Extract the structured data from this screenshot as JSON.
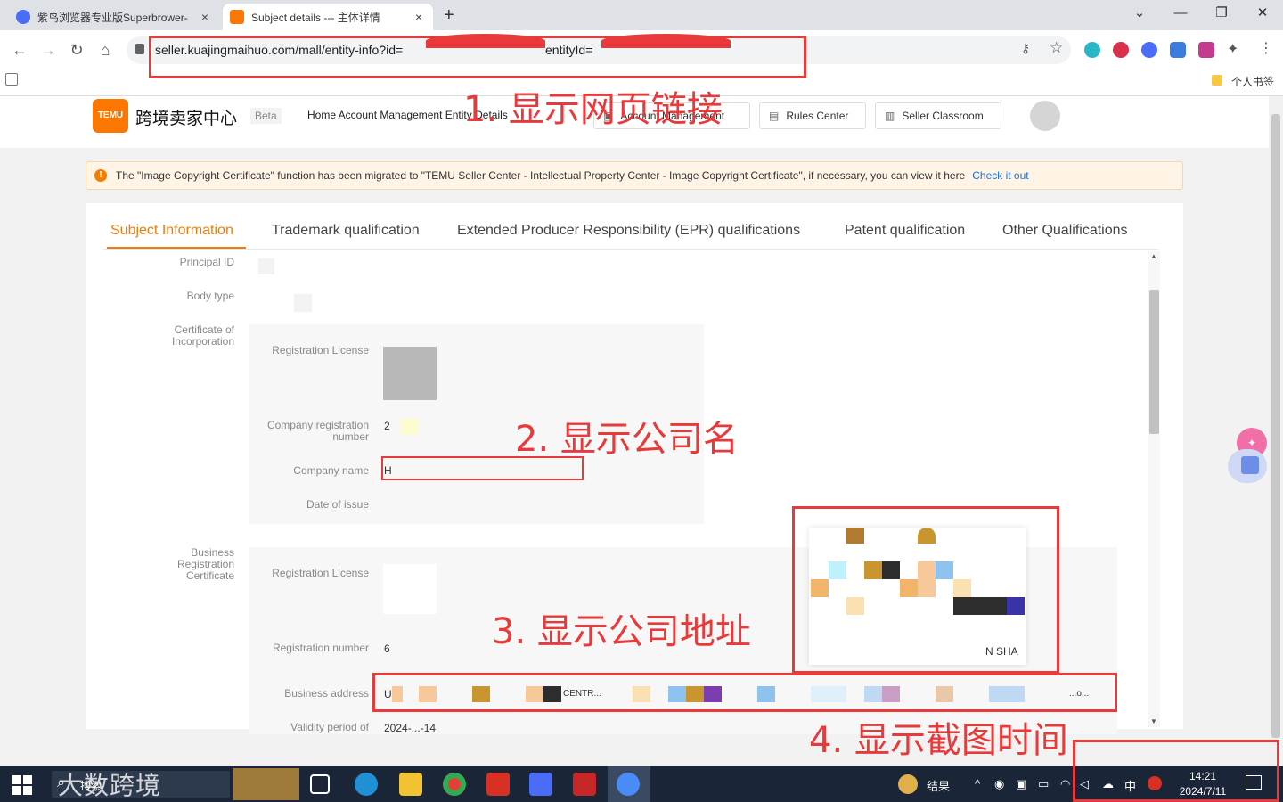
{
  "browser": {
    "tabs": [
      {
        "title": "紫鸟浏览器专业版Superbrower-",
        "close": "×"
      },
      {
        "title": "Subject details --- 主体详情",
        "close": "×"
      }
    ],
    "new_tab": "+",
    "window_controls": {
      "dropdown": "⌄",
      "minimize": "—",
      "restore": "❐",
      "close": "✕"
    },
    "url_prefix": "seller.kuajingmaihuo.com/mall/entity-info?id=",
    "url_suffix": "entityId=",
    "bookmark_label": "个人书签"
  },
  "header": {
    "logo_text": "TEMU",
    "brand": "跨境卖家中心",
    "beta": "Beta",
    "breadcrumb": "Home Account Management Entity Details",
    "buttons": [
      {
        "label": "Account Management"
      },
      {
        "label": "Rules Center"
      },
      {
        "label": "Seller Classroom"
      }
    ]
  },
  "notice": {
    "icon": "!",
    "text": "The \"Image Copyright Certificate\" function has been migrated to \"TEMU Seller Center - Intellectual Property Center - Image Copyright Certificate\", if necessary, you can view it here",
    "link": "Check it out"
  },
  "tabs": [
    {
      "label": "Subject Information",
      "active": true
    },
    {
      "label": "Trademark qualification"
    },
    {
      "label": "Extended Producer Responsibility (EPR) qualifications"
    },
    {
      "label": "Patent qualification"
    },
    {
      "label": "Other Qualifications"
    }
  ],
  "fields": {
    "principal_id": "Principal ID",
    "body_type": "Body type",
    "certificate_of_incorporation": "Certificate of Incorporation",
    "registration_license": "Registration License",
    "company_registration_number": "Company registration number",
    "company_registration_value": "2",
    "company_name": "Company name",
    "company_name_value": "H",
    "date_of_issue": "Date of issue",
    "business_registration_certificate": "Business Registration Certificate",
    "registration_license_2": "Registration License",
    "registration_number": "Registration number",
    "registration_number_value": "6",
    "business_address": "Business address",
    "business_address_value": "U",
    "business_address_fragment": "CENTR...",
    "business_address_end": "...o...",
    "validity_period": "Validity period of",
    "validity_value": "2024-...-14",
    "address_image_text": "N SHA"
  },
  "annotations": [
    "1. 显示网页链接",
    "2. 显示公司名",
    "3. 显示公司地址",
    "4. 显示截图时间"
  ],
  "taskbar": {
    "search": "搜索",
    "watermark": "大数跨境",
    "weather": "结果",
    "ime": "中",
    "time": "14:21",
    "date": "2024/7/11"
  },
  "colors": {
    "temu_orange": "#fb7701",
    "annotation_red": "#e83a3a",
    "tab_active": "#f07b0a",
    "link": "#1a73e8"
  }
}
